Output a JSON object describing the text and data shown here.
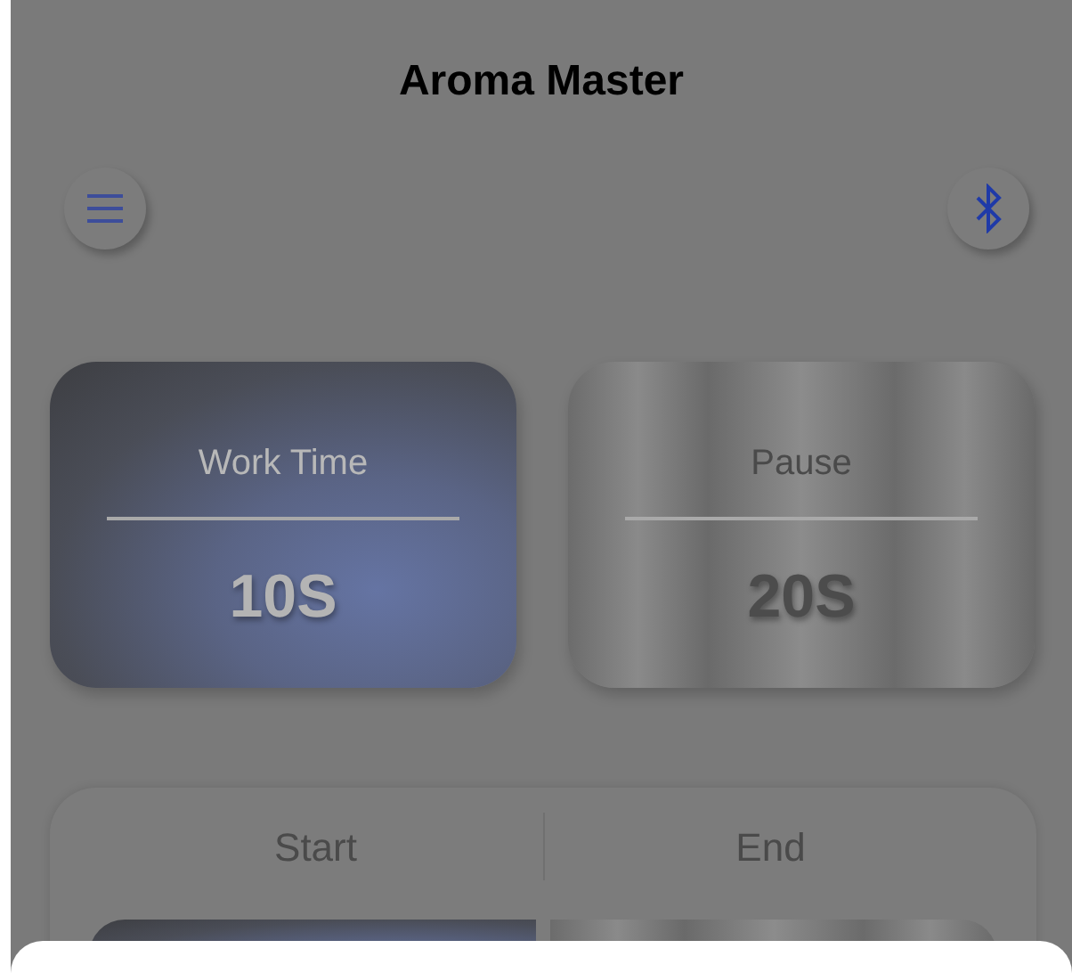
{
  "header": {
    "title": "Aroma Master"
  },
  "timers": [
    {
      "kind": "work",
      "label": "Work Time",
      "value": "10S"
    },
    {
      "kind": "pause",
      "label": "Pause",
      "value": "20S"
    }
  ],
  "controls": [
    {
      "label": "Start"
    },
    {
      "label": "End"
    }
  ],
  "tiles": [
    {
      "kind": "work"
    },
    {
      "kind": "pause"
    }
  ]
}
